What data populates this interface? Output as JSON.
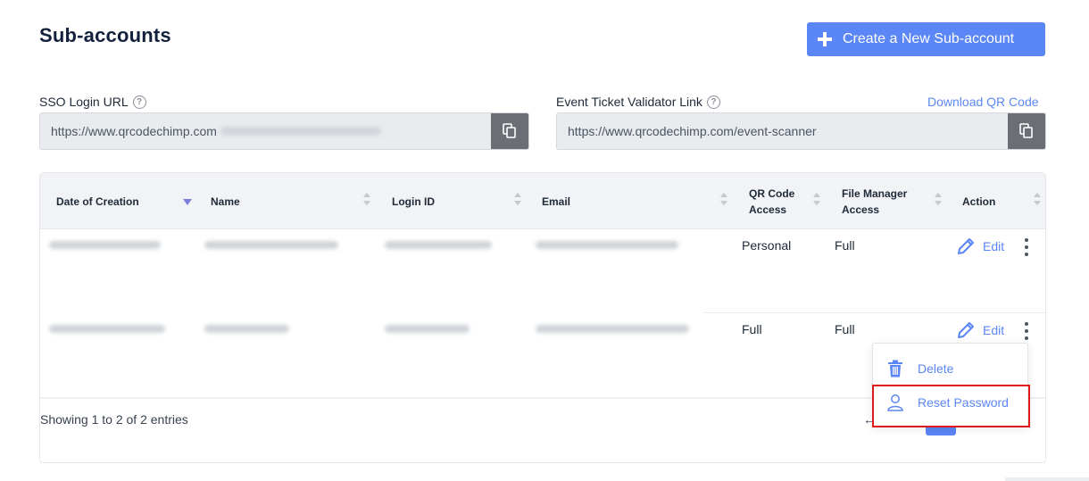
{
  "page": {
    "title": "Sub-accounts"
  },
  "header": {
    "create_button_label": "Create a New Sub-account"
  },
  "sso": {
    "label": "SSO Login URL",
    "url_prefix": "https://www.qrcodechimp.com"
  },
  "validator": {
    "label": "Event Ticket Validator Link",
    "url": "https://www.qrcodechimp.com/event-scanner",
    "download_label": "Download QR Code"
  },
  "table": {
    "columns": [
      "Date of Creation",
      "Name",
      "Login ID",
      "Email",
      "QR Code Access",
      "File Manager Access",
      "Action"
    ],
    "rows": [
      {
        "qr_code_access": "Personal",
        "file_manager_access": "Full",
        "action_label": "Edit"
      },
      {
        "qr_code_access": "Full",
        "file_manager_access": "Full",
        "action_label": "Edit"
      }
    ],
    "entries_text": "Showing 1 to 2 of 2 entries"
  },
  "menu": {
    "items": [
      {
        "label": "Delete",
        "icon": "trash-icon"
      },
      {
        "label": "Reset Password",
        "icon": "user-icon"
      }
    ]
  },
  "colors": {
    "accent": "#5b86f5",
    "title": "#14213d",
    "highlight_border": "#e01a1a",
    "copy_button": "#6b6f75"
  }
}
